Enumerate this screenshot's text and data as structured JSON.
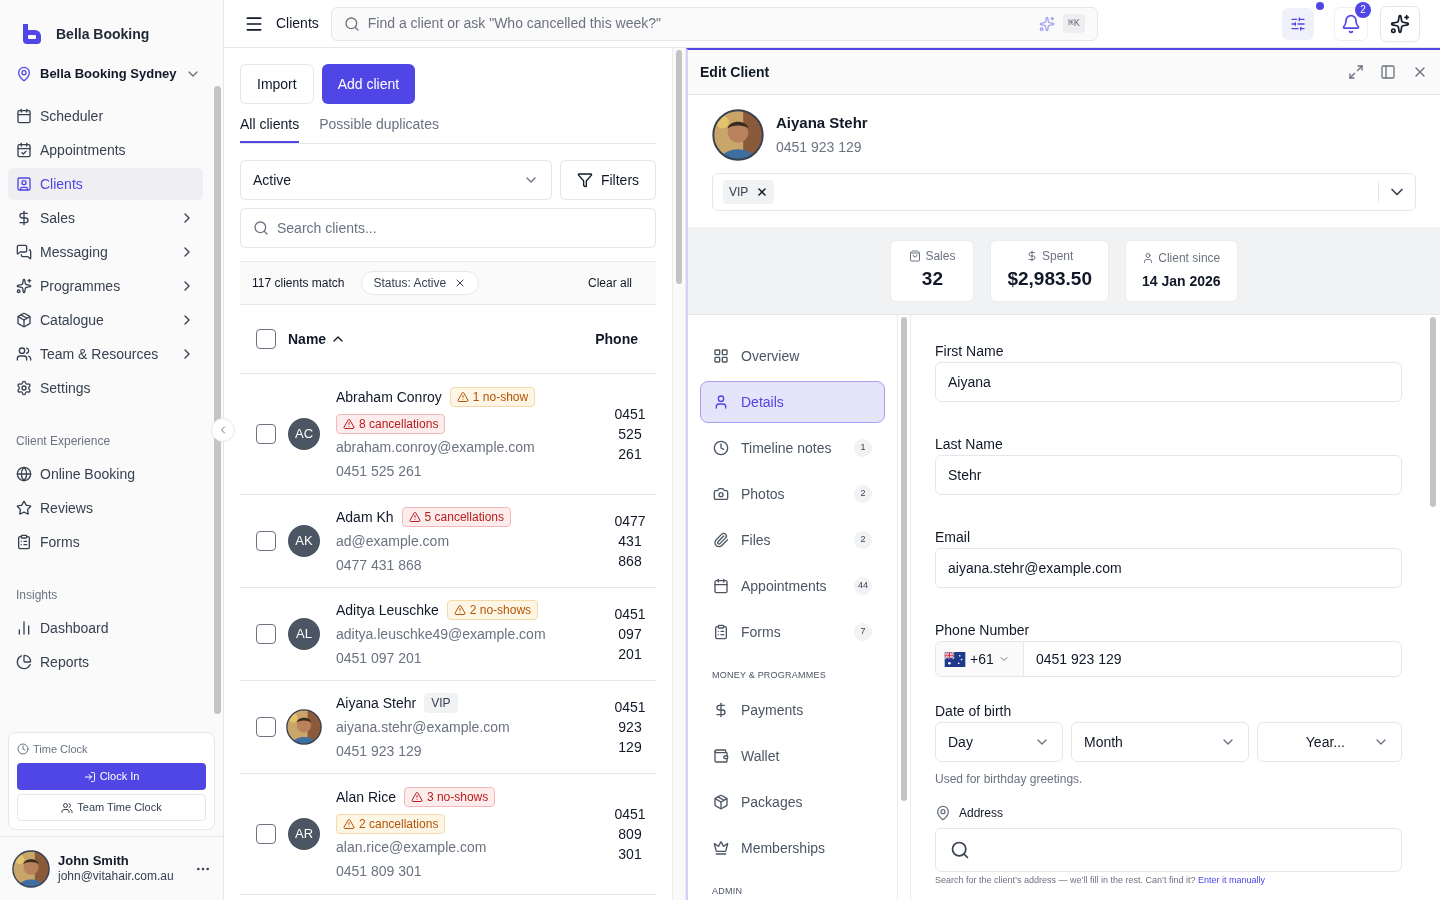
{
  "sidebar": {
    "brand": "Bella Booking",
    "location": "Bella Booking Sydney",
    "groups": [
      {
        "items": [
          {
            "label": "Scheduler",
            "has_submenu": false,
            "selected": false
          },
          {
            "label": "Appointments",
            "has_submenu": false,
            "selected": false
          },
          {
            "label": "Clients",
            "has_submenu": false,
            "selected": true
          },
          {
            "label": "Sales",
            "has_submenu": true,
            "selected": false
          },
          {
            "label": "Messaging",
            "has_submenu": true,
            "selected": false
          },
          {
            "label": "Programmes",
            "has_submenu": true,
            "selected": false
          },
          {
            "label": "Catalogue",
            "has_submenu": true,
            "selected": false
          },
          {
            "label": "Team & Resources",
            "has_submenu": true,
            "selected": false
          },
          {
            "label": "Settings",
            "has_submenu": false,
            "selected": false
          }
        ]
      },
      {
        "title": "Client Experience",
        "items": [
          {
            "label": "Online Booking",
            "has_submenu": false,
            "selected": false
          },
          {
            "label": "Reviews",
            "has_submenu": false,
            "selected": false
          },
          {
            "label": "Forms",
            "has_submenu": false,
            "selected": false
          }
        ]
      },
      {
        "title": "Insights",
        "items": [
          {
            "label": "Dashboard",
            "has_submenu": false,
            "selected": false
          },
          {
            "label": "Reports",
            "has_submenu": false,
            "selected": false
          }
        ]
      }
    ],
    "time_clock": {
      "title": "Time Clock",
      "primary": "Clock In",
      "secondary": "Team Time Clock"
    },
    "user": {
      "name": "John Smith",
      "email": "john@vitahair.com.au"
    }
  },
  "topbar": {
    "title": "Clients",
    "search_placeholder": "Find a client or ask \"Who cancelled this week?\"",
    "shortcut": "⌘K",
    "notification_count": "2",
    "filters_dot": true
  },
  "clients": {
    "buttons": [
      "Import",
      "Add client"
    ],
    "tabs": [
      {
        "label": "All clients",
        "selected": true
      },
      {
        "label": "Possible duplicates",
        "selected": false
      }
    ],
    "status_filter": "Active",
    "filters_button": "Filters",
    "search_placeholder": "Search clients...",
    "match_count": "117 clients match",
    "chip": "Status: Active",
    "clear": "Clear all",
    "header_checked": false,
    "columns": [
      "Name",
      "Phone"
    ],
    "rows": [
      {
        "name": "Abraham Conroy",
        "avatar": {
          "kind": "initials",
          "initials": "AC"
        },
        "checked": false,
        "badges": [
          {
            "label": "1 no-show",
            "kind": "warning"
          },
          {
            "label": "8 cancellations",
            "kind": "danger"
          }
        ],
        "email": "abraham.conroy@example.com",
        "phone": "0451 525 261",
        "phone_column": "0451 525 261"
      },
      {
        "name": "Adam Kh",
        "avatar": {
          "kind": "initials",
          "initials": "AK"
        },
        "checked": false,
        "badges": [
          {
            "label": "5 cancellations",
            "kind": "danger"
          }
        ],
        "email": "ad@example.com",
        "phone": "0477 431 868",
        "phone_column": "0477 431 868"
      },
      {
        "name": "Aditya Leuschke",
        "avatar": {
          "kind": "initials",
          "initials": "AL"
        },
        "checked": false,
        "badges": [
          {
            "label": "2 no-shows",
            "kind": "warning"
          }
        ],
        "email": "aditya.leuschke49@example.com",
        "phone": "0451 097 201",
        "phone_column": "0451 097 201"
      },
      {
        "name": "Aiyana Stehr",
        "avatar": {
          "kind": "picture"
        },
        "checked": false,
        "badges": [
          {
            "label": "VIP",
            "kind": "tag"
          }
        ],
        "email": "aiyana.stehr@example.com",
        "phone": "0451 923 129",
        "phone_column": "0451 923 129"
      },
      {
        "name": "Alan Rice",
        "avatar": {
          "kind": "initials",
          "initials": "AR"
        },
        "checked": false,
        "badges": [
          {
            "label": "3 no-shows",
            "kind": "danger"
          },
          {
            "label": "2 cancellations",
            "kind": "warning"
          }
        ],
        "email": "alan.rice@example.com",
        "phone": "0451 809 301",
        "phone_column": "0451 809 301"
      }
    ]
  },
  "edit_client": {
    "title": "Edit Client",
    "name": "Aiyana Stehr",
    "phone": "0451 923 129",
    "tags": [
      "VIP"
    ],
    "stats": [
      {
        "label": "Sales",
        "value": "32"
      },
      {
        "label": "Spent",
        "value": "$2,983.50"
      },
      {
        "label": "Client since",
        "value": "14 Jan 2026"
      }
    ],
    "nav": [
      {
        "items": [
          {
            "label": "Overview",
            "selected": false
          },
          {
            "label": "Details",
            "selected": true
          },
          {
            "label": "Timeline notes",
            "count": "1",
            "selected": false
          },
          {
            "label": "Photos",
            "count": "2",
            "selected": false
          },
          {
            "label": "Files",
            "count": "2",
            "selected": false
          },
          {
            "label": "Appointments",
            "count": "44",
            "selected": false
          },
          {
            "label": "Forms",
            "count": "7",
            "selected": false
          }
        ]
      },
      {
        "title": "MONEY & PROGRAMMES",
        "items": [
          {
            "label": "Payments",
            "selected": false
          },
          {
            "label": "Wallet",
            "selected": false
          },
          {
            "label": "Packages",
            "selected": false
          },
          {
            "label": "Memberships",
            "selected": false
          }
        ]
      },
      {
        "title": "ADMIN"
      }
    ],
    "form": {
      "first_name": {
        "label": "First Name",
        "value": "Aiyana"
      },
      "last_name": {
        "label": "Last Name",
        "value": "Stehr"
      },
      "email": {
        "label": "Email",
        "value": "aiyana.stehr@example.com"
      },
      "phone": {
        "label": "Phone Number",
        "country_code": "+61",
        "value": "0451 923 129"
      },
      "dob": {
        "label": "Date of birth",
        "day": "Day",
        "month": "Month",
        "year": "Year...",
        "hint": "Used for birthday greetings."
      },
      "address": {
        "label": "Address",
        "hint": "Search for the client’s address — we’ll fill in the rest. Can’t find it?",
        "link": "Enter it manually"
      }
    }
  }
}
